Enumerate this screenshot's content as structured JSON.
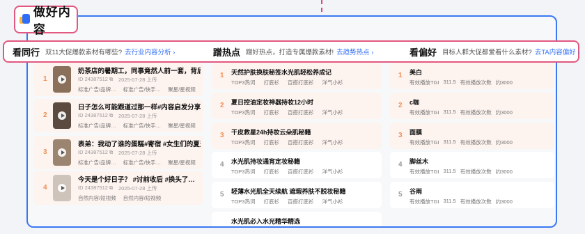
{
  "title": {
    "text": "做好内容"
  },
  "header": {
    "peers": {
      "heading": "看同行",
      "desc": "双11大促爆款素材有哪些?",
      "link": "去行业内容分析 ›"
    },
    "hot": {
      "heading": "蹭热点",
      "desc": "蹭好热点，打造专属爆款素材!",
      "link": "去趋势热点 ›"
    },
    "prefs": {
      "heading": "看偏好",
      "desc": "目标人群大促都爱看什么素材?",
      "link": "去TA内容偏好 ›"
    }
  },
  "videos": [
    {
      "rank": "1",
      "title": "奶茶店的暑期工，同事竟然人前一套，背后一…",
      "id": "ID 243875​12 ⧉",
      "date": "2025-07-28 上传",
      "tags": [
        "标准广告/品牌…",
        "标准广告/快手…",
        "聚星/星视频"
      ]
    },
    {
      "rank": "2",
      "title": "日子怎么可能跟道过那一样#内容启发分享计划…",
      "id": "ID 24387512 ⧉",
      "date": "2025-07-28 上传",
      "tags": [
        "标准广告/品牌…",
        "标准广告/快手…",
        "聚星/星视频"
      ]
    },
    {
      "rank": "3",
      "title": "表弟：我动了谁的蛋糕#寄宿 #女生们的夏天",
      "id": "ID 24387512 ⧉",
      "date": "2025-07-28 上传",
      "tags": [
        "标准广告/品牌…",
        "标准广告/快手…",
        "聚星/星视频"
      ]
    },
    {
      "rank": "4",
      "title": "今天是个好日子？ #讨前收后 #换头了…",
      "id": "ID 24387512 ⧉",
      "date": "2025-07-28 上传",
      "tags": [
        "自然内容/短视频",
        "自然内容/短视频"
      ]
    }
  ],
  "hotspots": [
    {
      "rank": "1",
      "title": "天然护肤换肤秘签水光肌轻松养成记",
      "tags": [
        "TOP3热词",
        "打底衫",
        "百搭打底衫",
        "洋气小衫"
      ]
    },
    {
      "rank": "2",
      "title": "夏日控油定妆神器持妆12小时",
      "tags": [
        "TOP3热词",
        "打底衫",
        "百搭打底衫",
        "洋气小衫"
      ]
    },
    {
      "rank": "3",
      "title": "干皮救星24h持妆云朵肌秘籍",
      "tags": [
        "TOP3热词",
        "打底衫",
        "百搭打底衫",
        "洋气小衫"
      ]
    },
    {
      "rank": "4",
      "title": "水光肌持妆通宵定妆秘籍",
      "tags": [
        "TOP3热词",
        "打底衫",
        "百搭打底衫",
        "洋气小衫"
      ]
    },
    {
      "rank": "5",
      "title": "轻薄水光肌全天续航 遮瑕养肤不脱妆秘籍",
      "tags": [
        "TOP3热词",
        "打底衫",
        "百搭打底衫",
        "洋气小衫"
      ]
    },
    {
      "rank": "",
      "title": "水光肌必入水光精华精选",
      "tags": []
    }
  ],
  "prefs": [
    {
      "rank": "1",
      "name": "美白",
      "stats": [
        "有效播放TGI",
        "311.5",
        "有效播放次数",
        "约3000"
      ]
    },
    {
      "rank": "2",
      "name": "c咖",
      "stats": [
        "有效播放TGI",
        "311.5",
        "有效播放次数",
        "约3000"
      ]
    },
    {
      "rank": "3",
      "name": "面膜",
      "stats": [
        "有效播放TGI",
        "311.5",
        "有效播放次数",
        "约3000"
      ]
    },
    {
      "rank": "4",
      "name": "脚丝木",
      "stats": [
        "有效播放TGI",
        "311.5",
        "有效播放次数",
        "约3000"
      ]
    },
    {
      "rank": "5",
      "name": "谷雨",
      "stats": [
        "有效播放TGI",
        "311.5",
        "有效播放次数",
        "约3000"
      ]
    }
  ],
  "colors": {
    "accent_blue": "#3a78f2",
    "highlight_pink": "#e2577f",
    "rank_orange": "#f08f56"
  }
}
